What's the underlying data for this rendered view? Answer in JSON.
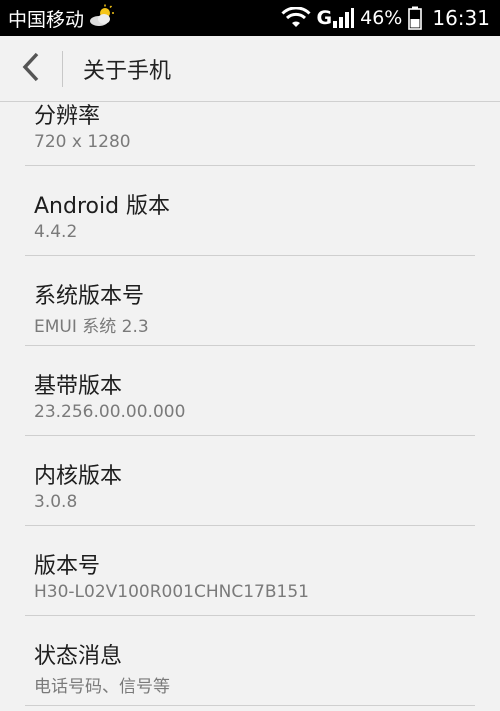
{
  "status_bar": {
    "carrier": "中国移动",
    "network_type": "G",
    "battery": "46%",
    "time": "16:31",
    "icons": [
      "weather-icon",
      "wifi-icon",
      "signal-icon",
      "battery-icon"
    ]
  },
  "header": {
    "title": "关于手机",
    "back_icon": "chevron-left-icon"
  },
  "items": [
    {
      "title": "分辨率",
      "value": "720 x 1280"
    },
    {
      "title": "Android 版本",
      "value": "4.4.2"
    },
    {
      "title": "系统版本号",
      "value": "EMUI 系统 2.3"
    },
    {
      "title": "基带版本",
      "value": "23.256.00.00.000"
    },
    {
      "title": "内核版本",
      "value": "3.0.8"
    },
    {
      "title": "版本号",
      "value": "H30-L02V100R001CHNC17B151"
    },
    {
      "title": "状态消息",
      "value": "电话号码、信号等"
    }
  ]
}
